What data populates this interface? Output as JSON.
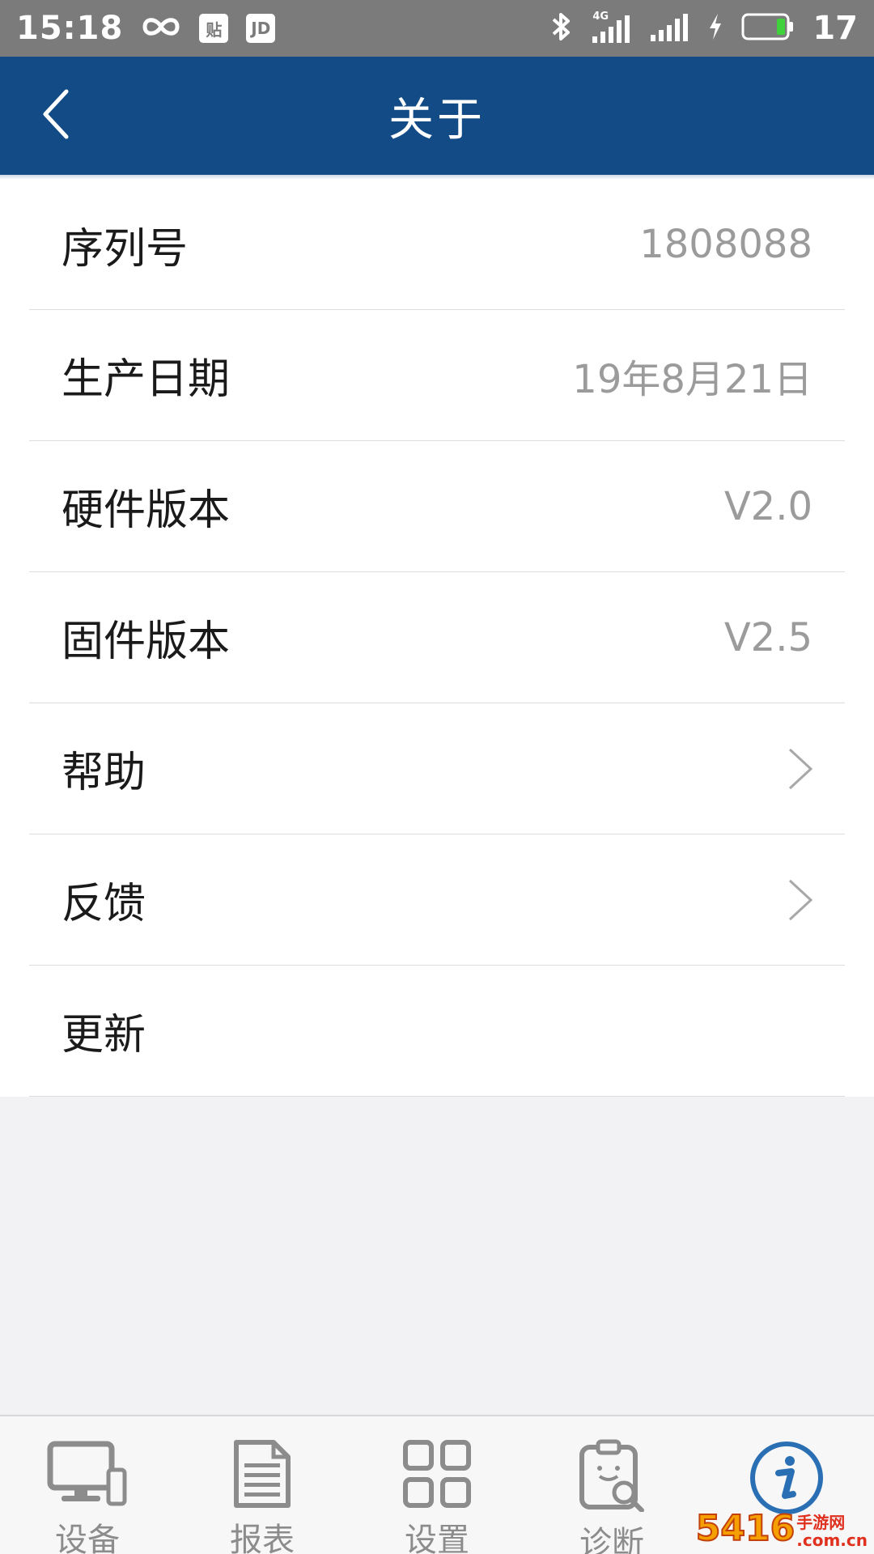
{
  "status_bar": {
    "time": "15:18",
    "left_icons": [
      "infinity-icon",
      "tieba-icon",
      "jd-icon"
    ],
    "tieba_glyph": "贴",
    "jd_glyph": "JD",
    "right_icons": [
      "bluetooth-icon",
      "signal-4g-icon",
      "signal-icon",
      "charging-icon",
      "battery-icon"
    ],
    "network_label": "4G",
    "battery_level": "17"
  },
  "header": {
    "title": "关于",
    "back_icon": "chevron-left-icon",
    "background": "#134b86"
  },
  "list": {
    "items": [
      {
        "label": "序列号",
        "value": "1808088"
      },
      {
        "label": "生产日期",
        "value": "19年8月21日"
      },
      {
        "label": "硬件版本",
        "value": "V2.0"
      },
      {
        "label": "固件版本",
        "value": "V2.5"
      },
      {
        "label": "帮助",
        "icon": "chevron-right-icon"
      },
      {
        "label": "反馈",
        "icon": "chevron-right-icon"
      },
      {
        "label": "更新"
      }
    ]
  },
  "bottom_nav": {
    "items": [
      {
        "label": "设备",
        "icon": "device-icon"
      },
      {
        "label": "报表",
        "icon": "report-icon"
      },
      {
        "label": "设置",
        "icon": "grid-settings-icon"
      },
      {
        "label": "诊断",
        "icon": "diagnosis-icon"
      },
      {
        "label": "",
        "icon": "info-icon",
        "active": true
      }
    ],
    "active_color": "#2a6fb3",
    "inactive_color": "#8c8c8c"
  },
  "watermark": {
    "main": "5416",
    "sub_top": "手游网",
    "sub_bottom": ".com.cn"
  }
}
